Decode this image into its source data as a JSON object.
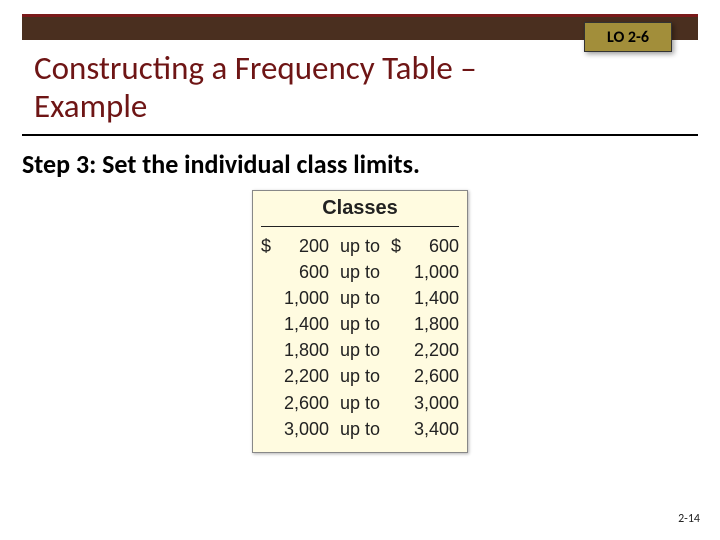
{
  "badge": {
    "label": "LO 2-6"
  },
  "title": "Constructing a Frequency Table – Example",
  "step": "Step 3: Set the individual class limits.",
  "classes": {
    "header": "Classes",
    "currency": "$",
    "upto": "up to",
    "rows": [
      {
        "low": "200",
        "high": "600",
        "show_sym_low": true,
        "show_sym_high": true
      },
      {
        "low": "600",
        "high": "1,000",
        "show_sym_low": false,
        "show_sym_high": false
      },
      {
        "low": "1,000",
        "high": "1,400",
        "show_sym_low": false,
        "show_sym_high": false
      },
      {
        "low": "1,400",
        "high": "1,800",
        "show_sym_low": false,
        "show_sym_high": false
      },
      {
        "low": "1,800",
        "high": "2,200",
        "show_sym_low": false,
        "show_sym_high": false
      },
      {
        "low": "2,200",
        "high": "2,600",
        "show_sym_low": false,
        "show_sym_high": false
      },
      {
        "low": "2,600",
        "high": "3,000",
        "show_sym_low": false,
        "show_sym_high": false
      },
      {
        "low": "3,000",
        "high": "3,400",
        "show_sym_low": false,
        "show_sym_high": false
      }
    ]
  },
  "pagenum": "2-14"
}
